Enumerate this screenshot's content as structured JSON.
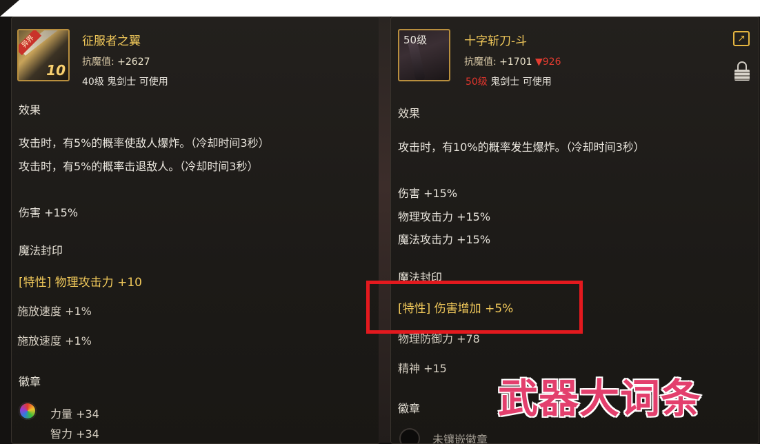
{
  "left_item": {
    "name": "征服者之翼",
    "icon_tag": "异界",
    "icon_level": "10",
    "anti_magic_label": "抗魔值",
    "anti_magic_value": "+2627",
    "requirement": "40级 鬼剑士 可使用",
    "effect_title": "效果",
    "effects": [
      "攻击时，有5%的概率使敌人爆炸。（冷却时间3秒）",
      "攻击时，有5%的概率击退敌人。（冷却时间3秒）"
    ],
    "stats": [
      "伤害 +15%"
    ],
    "magic_seal_title": "魔法封印",
    "magic_seal_trait": "[特性] 物理攻击力 +10",
    "magic_seal_lines": [
      "施放速度 +1%",
      "施放速度 +1%"
    ],
    "emblem_title": "徽章",
    "emblem_lines": [
      "力量 +34",
      "智力 +34"
    ]
  },
  "right_item": {
    "name": "十字斩刀-斗",
    "icon_level": "50级",
    "anti_magic_label": "抗魔值",
    "anti_magic_value": "+1701",
    "anti_magic_diff": "▼926",
    "requirement_level": "50级",
    "requirement_rest": "鬼剑士 可使用",
    "effect_title": "效果",
    "effects": [
      "攻击时，有10%的概率发生爆炸。（冷却时间3秒）"
    ],
    "stats": [
      "伤害 +15%",
      "物理攻击力 +15%",
      "魔法攻击力 +15%"
    ],
    "magic_seal_title": "魔法封印",
    "magic_seal_trait": "[特性] 伤害增加 +5%",
    "magic_seal_lines": [
      "物理防御力 +78",
      "精神 +15"
    ],
    "emblem_title": "徽章",
    "emblem_slot_text": "未镶嵌徽章"
  },
  "overlay_caption": "武器大词条",
  "colors": {
    "gold": "#f0c85a",
    "red_highlight": "#e3191e",
    "caption_pink": "#e33f6d",
    "panel_bg": "#1c1a17"
  },
  "icons": [
    "link-icon",
    "lock-icon",
    "emblem-orb-icon",
    "empty-slot-icon"
  ]
}
